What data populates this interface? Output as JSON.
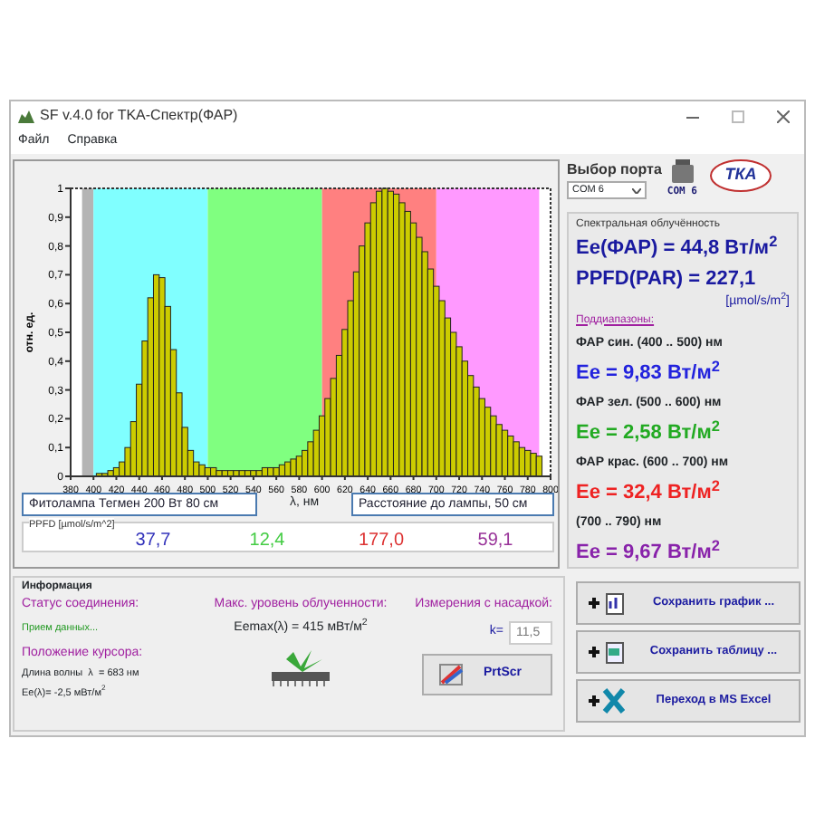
{
  "window": {
    "title": "SF v.4.0 for TKA-Спектр(ФАР)"
  },
  "menu": [
    "Файл",
    "Справка"
  ],
  "chart": {
    "chart_data": {
      "type": "bar",
      "ylabel": "отн. ед.",
      "xlabel": "λ, нм",
      "x": [
        400,
        405,
        410,
        415,
        420,
        425,
        430,
        435,
        440,
        445,
        450,
        455,
        460,
        465,
        470,
        475,
        480,
        485,
        490,
        495,
        500,
        505,
        510,
        515,
        520,
        525,
        530,
        535,
        540,
        545,
        550,
        555,
        560,
        565,
        570,
        575,
        580,
        585,
        590,
        595,
        600,
        605,
        610,
        615,
        620,
        625,
        630,
        635,
        640,
        645,
        650,
        655,
        660,
        665,
        670,
        675,
        680,
        685,
        690,
        695,
        700,
        705,
        710,
        715,
        720,
        725,
        730,
        735,
        740,
        745,
        750,
        755,
        760,
        765,
        770,
        775,
        780,
        785,
        790
      ],
      "series": [
        {
          "color": "#cccc00",
          "values": [
            0,
            0.01,
            0.01,
            0.02,
            0.03,
            0.05,
            0.1,
            0.19,
            0.32,
            0.47,
            0.62,
            0.7,
            0.69,
            0.59,
            0.44,
            0.29,
            0.17,
            0.09,
            0.05,
            0.04,
            0.03,
            0.03,
            0.02,
            0.02,
            0.02,
            0.02,
            0.02,
            0.02,
            0.02,
            0.02,
            0.03,
            0.03,
            0.03,
            0.04,
            0.05,
            0.06,
            0.07,
            0.09,
            0.12,
            0.16,
            0.21,
            0.27,
            0.34,
            0.42,
            0.51,
            0.61,
            0.71,
            0.8,
            0.88,
            0.95,
            0.99,
            1,
            0.99,
            0.98,
            0.95,
            0.92,
            0.88,
            0.83,
            0.78,
            0.72,
            0.66,
            0.61,
            0.55,
            0.5,
            0.45,
            0.4,
            0.35,
            0.31,
            0.27,
            0.24,
            0.21,
            0.18,
            0.16,
            0.14,
            0.12,
            0.1,
            0.09,
            0.08,
            0.07
          ]
        }
      ],
      "xlim": [
        380,
        800
      ],
      "ylim": [
        0,
        1
      ],
      "xticks": [
        380,
        400,
        420,
        440,
        460,
        480,
        500,
        520,
        540,
        560,
        580,
        600,
        620,
        640,
        660,
        680,
        700,
        720,
        740,
        760,
        780,
        800
      ],
      "yticks": [
        {
          "value": 0,
          "label": "0"
        },
        {
          "value": 0.1,
          "label": "0,1"
        },
        {
          "value": 0.2,
          "label": "0,2"
        },
        {
          "value": 0.3,
          "label": "0,3"
        },
        {
          "value": 0.4,
          "label": "0,4"
        },
        {
          "value": 0.5,
          "label": "0,5"
        },
        {
          "value": 0.6,
          "label": "0,6"
        },
        {
          "value": 0.7,
          "label": "0,7"
        },
        {
          "value": 0.8,
          "label": "0,8"
        },
        {
          "value": 0.9,
          "label": "0,9"
        },
        {
          "value": 1,
          "label": "1"
        }
      ],
      "bands": [
        {
          "axis": "x",
          "from": 390,
          "to": 400,
          "color": "#b4b4b4"
        },
        {
          "axis": "x",
          "from": 400,
          "to": 500,
          "color": "#80ffff"
        },
        {
          "axis": "x",
          "from": 500,
          "to": 600,
          "color": "#80ff80"
        },
        {
          "axis": "x",
          "from": 600,
          "to": 700,
          "color": "#ff8080"
        },
        {
          "axis": "x",
          "from": 700,
          "to": 790,
          "color": "#ff99ff"
        }
      ]
    },
    "lamp_field": "Фитолампа Тегмен 200 Вт 80 см",
    "distance_field": "Расстояние до лампы, 50 см",
    "ppfd_label": "PPFD [µmol/s/m^2]",
    "ppfd_values": [
      {
        "text": "37,7",
        "color": "#3333bb"
      },
      {
        "text": "12,4",
        "color": "#44cc44"
      },
      {
        "text": "177,0",
        "color": "#dd3333"
      },
      {
        "text": "59,1",
        "color": "#993399"
      }
    ]
  },
  "port": {
    "label": "Выбор порта",
    "value": "COM 6",
    "device_label": "COM 6",
    "logo": "ТКА"
  },
  "irradiance": {
    "title": "Спектральная облучённость",
    "total": "Ee(ФАР) = 44,8 Вт/м$^{2}$",
    "ppfd": "PPFD(PAR) = 227,1",
    "ppfd_unit": "[µmol/s/m$^{2}$]",
    "subranges_title": "Поддиапазоны:",
    "subranges": [
      {
        "label": "ФАР син. (400 .. 500) нм",
        "value": "Ee = 9,83 Вт/м$^{2}$",
        "color": "#2222dd"
      },
      {
        "label": "ФАР зел. (500 .. 600) нм",
        "value": "Ee = 2,58 Вт/м$^{2}$",
        "color": "#22aa22"
      },
      {
        "label": "ФАР крас. (600 .. 700) нм",
        "value": "Ee = 32,4 Вт/м$^{2}$",
        "color": "#ee2222"
      },
      {
        "label": "(700 .. 790) нм",
        "value": "Ee = 9,67 Вт/м$^{2}$",
        "color": "#8822aa"
      }
    ]
  },
  "info": {
    "title": "Информация",
    "status_title": "Статус соединения:",
    "status": "Прием данных...",
    "cursor_title": "Положение курсора:",
    "wavelength": "Длина волны  λ  = 683 нм",
    "cursor_ee": "Ee(λ)= -2,5 мВт/м$^{2}$",
    "max_title": "Макс. уровень облученности:",
    "max_value": "Eemax(λ) = 415 мВт/м$^{2}$",
    "nozzle_title": "Измерения с насадкой:",
    "k_label": "k=",
    "k_value": "11,5",
    "prtscr": "PrtScr"
  },
  "buttons": [
    "Сохранить график ...",
    "Сохранить таблицу ...",
    "Переход в MS Excel"
  ]
}
